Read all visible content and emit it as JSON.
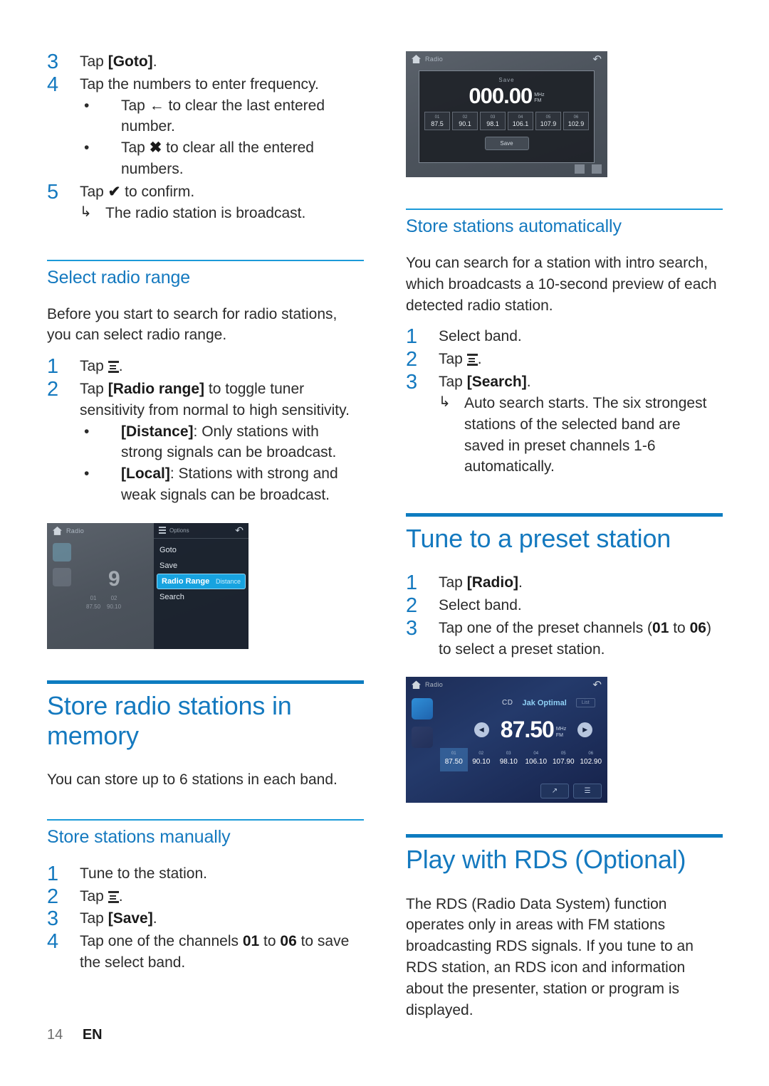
{
  "document": {
    "footer": {
      "page_number": "14",
      "language": "EN"
    },
    "accent_blue": "#1479bf",
    "rule_thin_color": "#1b9ad9",
    "rule_thick_color": "#0d7cc0"
  },
  "left_column": {
    "continued_steps": [
      {
        "num": "3",
        "text_before": "Tap ",
        "bold": "[Goto]",
        "text_after": "."
      },
      {
        "num": "4",
        "text_before": "Tap the numbers to enter frequency.",
        "bold": "",
        "text_after": ""
      }
    ],
    "step4_bullets": [
      {
        "bullet": "•",
        "before": "Tap ",
        "glyph": "←",
        "after": " to clear the last entered number."
      },
      {
        "bullet": "•",
        "before": "Tap ",
        "glyph": "✖",
        "after": " to clear all the entered numbers."
      }
    ],
    "step5": {
      "num": "5",
      "before": "Tap ",
      "glyph": "✔",
      "after": " to confirm."
    },
    "step5_result": {
      "arrow": "↳",
      "text": "The radio station is broadcast."
    },
    "select_radio_range": {
      "heading": "Select radio range",
      "intro": "Before you start to search for radio stations, you can select radio range.",
      "steps": [
        {
          "num": "1",
          "before": "Tap ",
          "icon": "menu-icon",
          "after": "."
        },
        {
          "num": "2",
          "before": "Tap ",
          "bold": "[Radio range]",
          "after": " to toggle tuner sensitivity from normal to high sensitivity."
        }
      ],
      "bullets": [
        {
          "bullet": "•",
          "bold": "[Distance]",
          "text": ": Only stations with strong signals can be broadcast."
        },
        {
          "bullet": "•",
          "bold": "[Local]",
          "text": ": Stations with strong and weak signals can be broadcast."
        }
      ]
    },
    "screenshot_options": {
      "topbar_title": "Radio",
      "back_icon": "↶",
      "big_frequency": "9",
      "mini_presets": [
        {
          "num": "01",
          "freq": "87.50"
        },
        {
          "num": "02",
          "freq": "90.10"
        }
      ],
      "menu_header": "Options",
      "menu_items": [
        {
          "label": "Goto",
          "value": "",
          "selected": false
        },
        {
          "label": "Save",
          "value": "",
          "selected": false
        },
        {
          "label": "Radio Range",
          "value": "Distance",
          "selected": true
        },
        {
          "label": "Search",
          "value": "",
          "selected": false
        }
      ]
    },
    "store_radio_stations": {
      "heading": "Store radio stations in memory",
      "intro": "You can store up to 6 stations in each band.",
      "manual": {
        "heading": "Store stations manually",
        "steps": [
          {
            "num": "1",
            "before": "Tune to the station.",
            "bold": "",
            "after": ""
          },
          {
            "num": "2",
            "before": "Tap ",
            "icon": "menu-icon",
            "after": "."
          },
          {
            "num": "3",
            "before": "Tap ",
            "bold": "[Save]",
            "after": "."
          },
          {
            "num": "4",
            "before": "Tap one of the channels ",
            "bold": "01",
            "mid": " to ",
            "bold2": "06",
            "after": " to save the select band."
          }
        ]
      }
    }
  },
  "right_column": {
    "screenshot_save": {
      "topbar_title": "Radio",
      "back_icon": "↶",
      "dialog_title": "Save",
      "frequency": "000.00",
      "unit_line1": "MHz",
      "unit_line2": "FM",
      "presets": [
        {
          "num": "01",
          "freq": "87.5"
        },
        {
          "num": "02",
          "freq": "90.1"
        },
        {
          "num": "03",
          "freq": "98.1"
        },
        {
          "num": "04",
          "freq": "106.1"
        },
        {
          "num": "05",
          "freq": "107.9"
        },
        {
          "num": "06",
          "freq": "102.9"
        }
      ],
      "save_button": "Save"
    },
    "store_stations_automatically": {
      "heading": "Store stations automatically",
      "intro": "You can search for a station with intro search, which broadcasts a 10-second preview of each detected radio station.",
      "steps": [
        {
          "num": "1",
          "before": "Select band.",
          "bold": "",
          "after": ""
        },
        {
          "num": "2",
          "before": "Tap ",
          "icon": "menu-icon",
          "after": "."
        },
        {
          "num": "3",
          "before": "Tap ",
          "bold": "[Search]",
          "after": "."
        }
      ],
      "result": {
        "arrow": "↳",
        "text": "Auto search starts. The six strongest stations of the selected band are saved in preset channels 1-6 automatically."
      }
    },
    "tune_to_preset": {
      "heading": "Tune to a preset station",
      "steps": [
        {
          "num": "1",
          "before": "Tap ",
          "bold": "[Radio]",
          "after": "."
        },
        {
          "num": "2",
          "before": "Select band.",
          "bold": "",
          "after": ""
        },
        {
          "num": "3",
          "before": "Tap one of the preset channels (",
          "bold": "01",
          "mid": " to ",
          "bold2": "06",
          "after": ") to select a preset station."
        }
      ]
    },
    "screenshot_radio": {
      "topbar_title": "Radio",
      "back_icon": "↶",
      "source": "CD",
      "station_name": "Jak Optimal",
      "tag": "List",
      "prev_icon": "◀",
      "next_icon": "▶",
      "frequency": "87.50",
      "unit_line1": "MHz",
      "unit_line2": "FM",
      "presets": [
        {
          "num": "01",
          "freq": "87.50",
          "active": true
        },
        {
          "num": "02",
          "freq": "90.10",
          "active": false
        },
        {
          "num": "03",
          "freq": "98.10",
          "active": false
        },
        {
          "num": "04",
          "freq": "106.10",
          "active": false
        },
        {
          "num": "05",
          "freq": "107.90",
          "active": false
        },
        {
          "num": "06",
          "freq": "102.90",
          "active": false
        }
      ],
      "bottom_buttons": [
        "↗",
        "☰"
      ]
    },
    "play_with_rds": {
      "heading": "Play with RDS (Optional)",
      "paragraph": "The RDS (Radio Data System) function operates only in areas with FM stations broadcasting RDS signals. If you tune to an RDS station, an RDS icon and information about the presenter, station or program is displayed."
    }
  }
}
